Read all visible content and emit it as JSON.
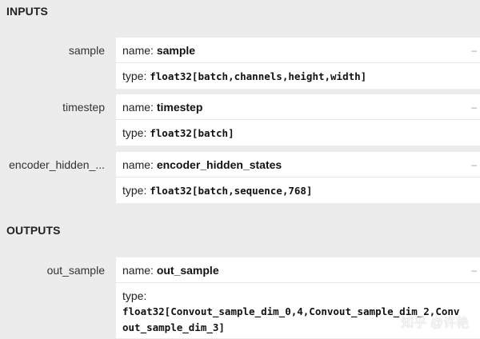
{
  "inputs_title": "INPUTS",
  "outputs_title": "OUTPUTS",
  "name_prefix": "name:",
  "type_prefix": "type:",
  "collapse_glyph": "–",
  "inputs": [
    {
      "label": "sample",
      "name": "sample",
      "type": "float32[batch,channels,height,width]"
    },
    {
      "label": "timestep",
      "name": "timestep",
      "type": "float32[batch]"
    },
    {
      "label": "encoder_hidden_...",
      "name": "encoder_hidden_states",
      "type": "float32[batch,sequence,768]"
    }
  ],
  "outputs": [
    {
      "label": "out_sample",
      "name": "out_sample",
      "type_line1": "float32[Convout_sample_dim_0,4,Convout_sample_dim_2,Conv",
      "type_line2": "out_sample_dim_3]"
    }
  ],
  "watermark": "知乎 @许艳"
}
